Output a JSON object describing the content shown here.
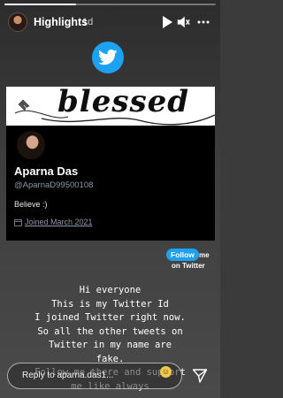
{
  "story": {
    "title": "Highlights",
    "time": "1d",
    "progress": 0.34
  },
  "card": {
    "banner_text": "blessed",
    "name": "Aparna Das",
    "handle": "@AparnaD99500108",
    "bio": "Believe :)",
    "joined": "Joined March 2021"
  },
  "sticker": {
    "follow": "Follow",
    "me": "me",
    "on_twitter": "on Twitter"
  },
  "message": {
    "text": "Hi everyone\nThis is my Twitter Id\nI joined Twitter right now.\nSo all the other tweets on\nTwitter in my name are\nfake.\nFollow me there and support\nme like always"
  },
  "reply": {
    "placeholder": "Reply to aparna.das1..."
  },
  "colors": {
    "twitter_blue": "#1da1f2",
    "card_bg": "#000000"
  },
  "icons": [
    "play-icon",
    "mute-icon",
    "more-icon",
    "twitter-bird-icon",
    "pin-icon",
    "calendar-icon",
    "send-icon"
  ]
}
